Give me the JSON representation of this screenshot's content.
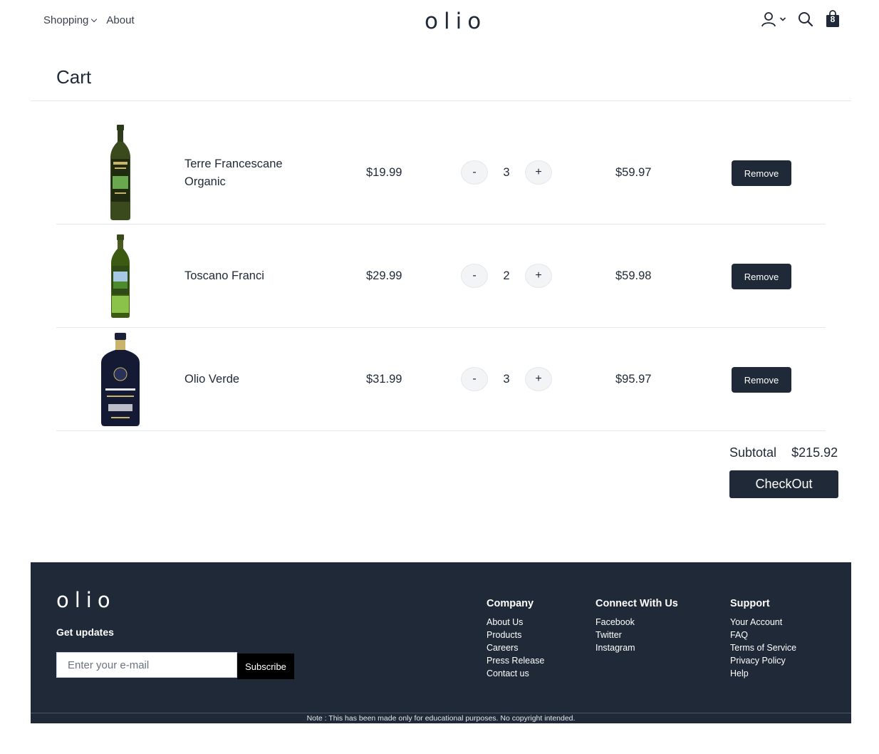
{
  "header": {
    "nav": [
      {
        "label": "Shopping",
        "has_dropdown": true
      },
      {
        "label": "About",
        "has_dropdown": false
      }
    ],
    "logo": "olio",
    "icons": [
      "user-icon",
      "chevron-down-icon",
      "search-icon",
      "bag-icon"
    ],
    "bag_count": "8"
  },
  "cart": {
    "title": "Cart",
    "items": [
      {
        "name": "Terre Francescane Organic",
        "price": "$19.99",
        "qty": "3",
        "total": "$59.97",
        "remove_label": "Remove"
      },
      {
        "name": "Toscano Franci",
        "price": "$29.99",
        "qty": "2",
        "total": "$59.98",
        "remove_label": "Remove"
      },
      {
        "name": "Olio Verde",
        "price": "$31.99",
        "qty": "3",
        "total": "$95.97",
        "remove_label": "Remove"
      }
    ],
    "decrement_label": "-",
    "increment_label": "+",
    "subtotal_label": "Subtotal",
    "subtotal_value": "$215.92",
    "checkout_label": "CheckOut"
  },
  "footer": {
    "logo": "olio",
    "updates_label": "Get updates",
    "email_placeholder": "Enter your e-mail",
    "subscribe_label": "Subscribe",
    "columns": [
      {
        "heading": "Company",
        "links": [
          "About Us",
          "Products",
          "Careers",
          "Press Release",
          "Contact us"
        ]
      },
      {
        "heading": "Connect With Us",
        "links": [
          "Facebook",
          "Twitter",
          "Instagram"
        ]
      },
      {
        "heading": "Support",
        "links": [
          "Your Account",
          "FAQ",
          "Terms of Service",
          "Privacy Policy",
          "Help"
        ]
      }
    ],
    "note": "Note : This has been made only for educational purposes. No copyright intended."
  },
  "colors": {
    "primary": "#1f2937",
    "border": "#e5e7eb",
    "qty_button_bg": "#f3f4f6",
    "subscribe_bg": "#000000"
  }
}
